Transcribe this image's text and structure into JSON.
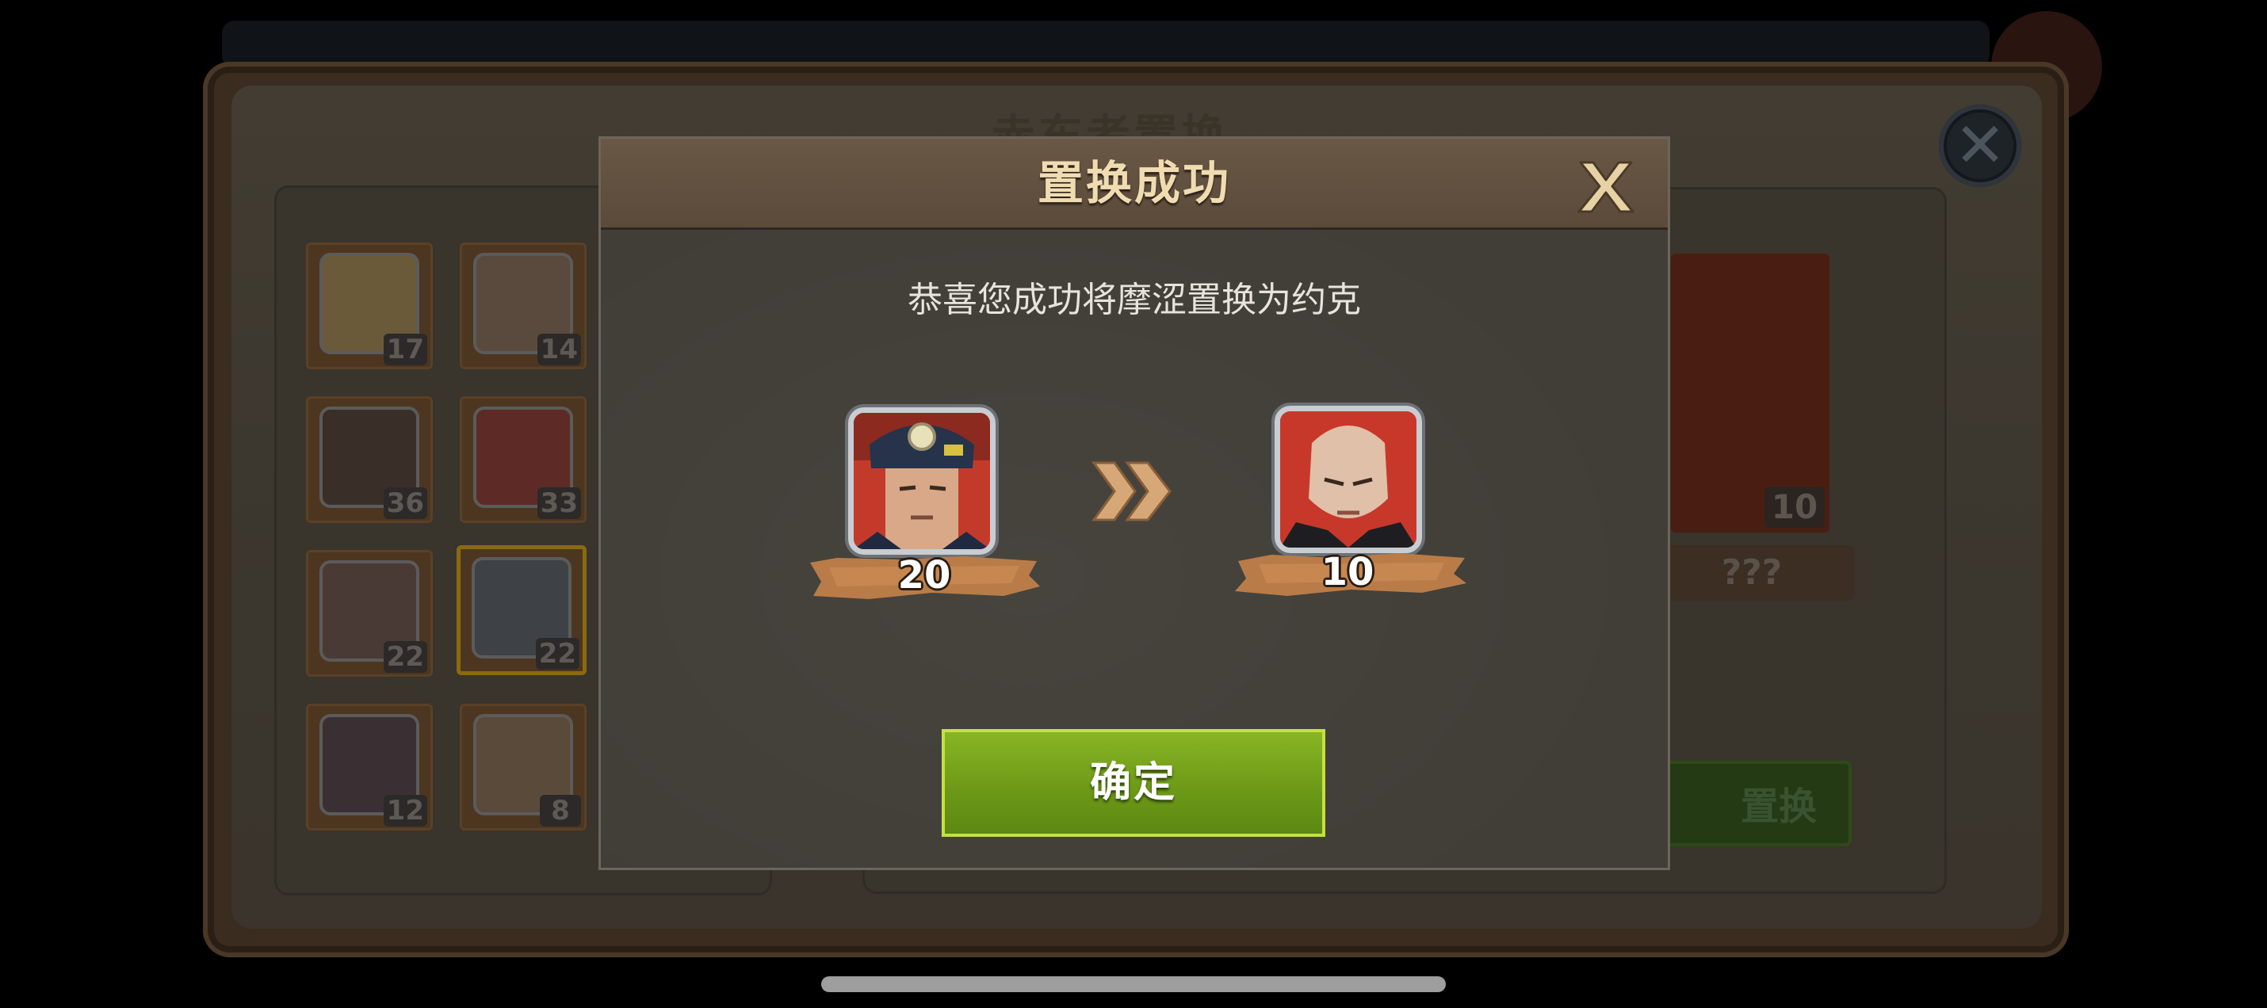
{
  "background": {
    "title": "赤东者置换",
    "left_list": {
      "heroes": [
        {
          "level": "17"
        },
        {
          "level": "14"
        },
        {
          "level": "36"
        },
        {
          "level": "33"
        },
        {
          "level": "22"
        },
        {
          "level": "22",
          "selected": true
        },
        {
          "level": "12"
        },
        {
          "level": "8"
        }
      ]
    },
    "target": {
      "level": "10",
      "name": "???"
    },
    "action_button": "置换"
  },
  "dialog": {
    "title": "置换成功",
    "message": "恭喜您成功将摩涩置换为约克",
    "from_hero": {
      "level": "20",
      "portrait": "officer-helmet-portrait"
    },
    "to_hero": {
      "level": "10",
      "portrait": "bald-man-portrait"
    },
    "arrow_icon": "double-chevron-right-icon",
    "confirm_label": "确定",
    "close_icon": "close-x-icon"
  },
  "colors": {
    "title_text": "#f1dcb2",
    "confirm_green": "#7aa81e",
    "confirm_border": "#c5e040",
    "brush_orange": "#c98a52"
  }
}
